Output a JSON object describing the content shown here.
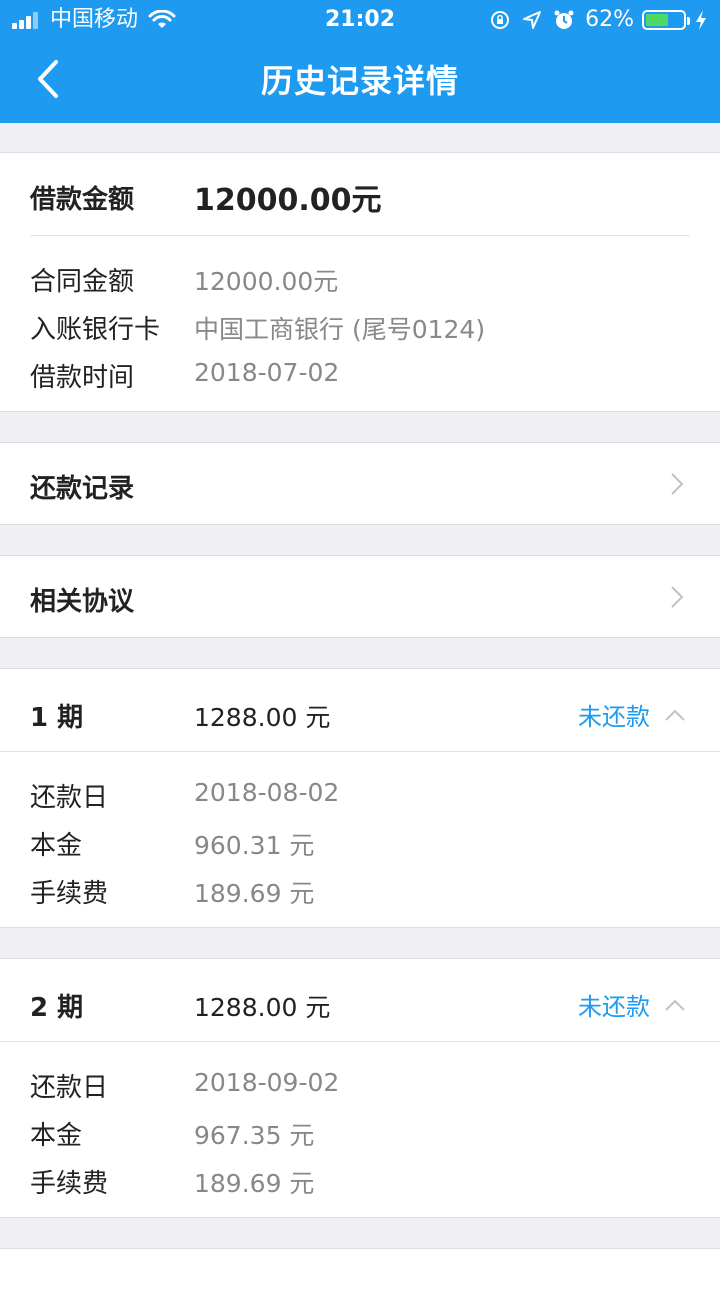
{
  "status_bar": {
    "carrier": "中国移动",
    "time": "21:02",
    "battery_percent": "62%",
    "battery_level": 0.62,
    "icons": [
      "signal-icon",
      "wifi-icon",
      "rotation-lock-icon",
      "location-icon",
      "alarm-icon",
      "battery-icon",
      "charging-icon"
    ]
  },
  "nav": {
    "title": "历史记录详情"
  },
  "loan": {
    "amount_label": "借款金额",
    "amount_value": "12000.00元",
    "contract_label": "合同金额",
    "contract_value": "12000.00元",
    "bank_label": "入账银行卡",
    "bank_value": "中国工商银行 (尾号0124)",
    "time_label": "借款时间",
    "time_value": "2018-07-02"
  },
  "links": [
    {
      "label": "还款记录"
    },
    {
      "label": "相关协议"
    }
  ],
  "installments": [
    {
      "period": "1 期",
      "amount": "1288.00 元",
      "status": "未还款",
      "due_label": "还款日",
      "due_value": "2018-08-02",
      "principal_label": "本金",
      "principal_value": "960.31 元",
      "fee_label": "手续费",
      "fee_value": "189.69 元"
    },
    {
      "period": "2 期",
      "amount": "1288.00 元",
      "status": "未还款",
      "due_label": "还款日",
      "due_value": "2018-09-02",
      "principal_label": "本金",
      "principal_value": "967.35 元",
      "fee_label": "手续费",
      "fee_value": "189.69 元"
    }
  ],
  "colors": {
    "accent": "#1e9bf0",
    "background": "#efeff4",
    "battery": "#4cd964"
  }
}
